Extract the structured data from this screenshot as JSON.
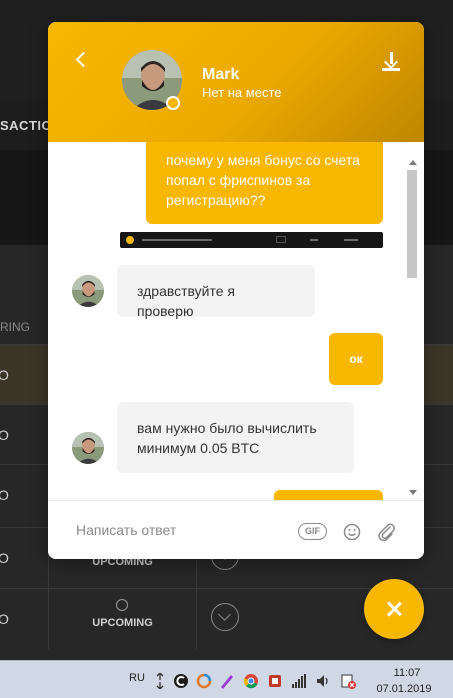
{
  "background": {
    "tab_text": "SACTIO",
    "column_header": "RING",
    "rows": [
      {
        "cell": "O",
        "status": ""
      },
      {
        "cell": "O",
        "status": ""
      },
      {
        "cell": "O",
        "status": ""
      },
      {
        "cell": "O",
        "status": "UPCOMING"
      },
      {
        "cell": "O",
        "status": "UPCOMING"
      }
    ]
  },
  "chat": {
    "header": {
      "agent_name": "Mark",
      "agent_status": "Нет на месте",
      "accent_color": "#f9b700"
    },
    "messages": [
      {
        "direction": "out",
        "text": "почему у меня бонус со счета попал с фриспинов за регистрацию??"
      },
      {
        "direction": "out",
        "type": "image",
        "text": ""
      },
      {
        "direction": "in",
        "text": "здравствуйте я проверю"
      },
      {
        "direction": "out",
        "text": "ок"
      },
      {
        "direction": "in",
        "text": "вам нужно было вычислить минимум 0.05 BTC"
      },
      {
        "direction": "out",
        "text": ""
      }
    ],
    "composer": {
      "placeholder": "Написать ответ",
      "value": "",
      "gif_label": "GIF",
      "icons": [
        "emoji-icon",
        "paperclip-icon"
      ]
    },
    "fab_icon": "close-icon"
  },
  "taskbar": {
    "language": "RU",
    "time": "11:07",
    "date": "07.01.2019"
  }
}
